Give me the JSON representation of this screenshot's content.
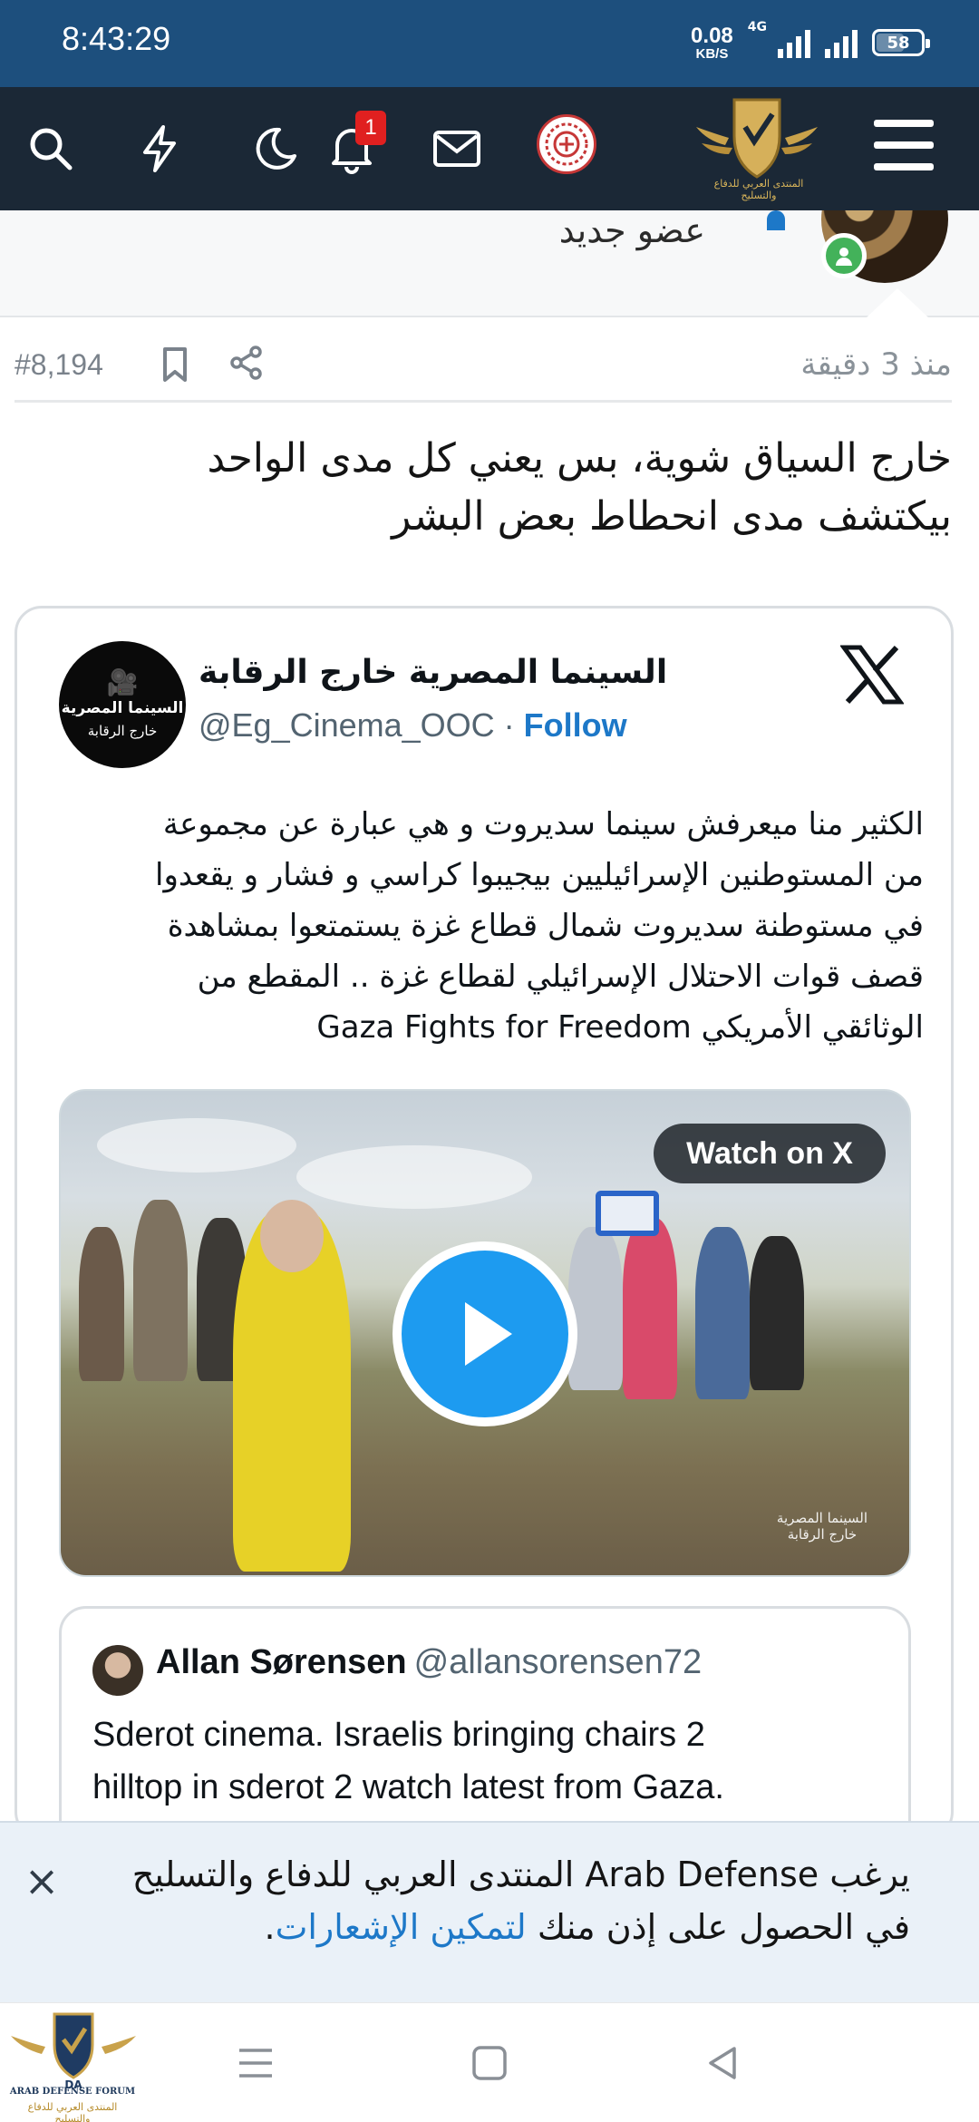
{
  "status_bar": {
    "time": "8:43:29",
    "net_speed": "0.08",
    "net_unit": "KB/S",
    "network_type": "4G",
    "battery": "58"
  },
  "nav": {
    "notification_count": "1",
    "icons": [
      "search-icon",
      "bolt-icon",
      "moon-icon",
      "bell-icon",
      "mail-icon",
      "avatar",
      "forum-logo",
      "menu-icon"
    ],
    "logo_caption": "المنتدى العربي للدفاع والتسليح"
  },
  "post": {
    "member_title": "عضو جديد",
    "time_ago": "منذ 3 دقيقة",
    "number": "#8,194",
    "text_line1": "خارج السياق شوية، بس يعني كل مدى الواحد",
    "text_line2": "بيكتشف مدى انحطاط بعض البشر"
  },
  "tweet": {
    "avatar_line1": "السينما المصرية",
    "avatar_line2": "خارج الرقابة",
    "name": "السينما المصرية خارج الرقابة",
    "handle": "@Eg_Cinema_OOC",
    "separator": " · ",
    "follow_label": "Follow",
    "text_lines": [
      "الكثير منا ميعرفش سينما سديروت و هي عبارة عن مجموعة",
      "من المستوطنين الإسرائيليين بيجيبوا كراسي و فشار و يقعدوا",
      "في مستوطنة سديروت شمال قطاع غزة يستمتعوا بمشاهدة",
      "قصف قوات الاحتلال الإسرائيلي لقطاع غزة .. المقطع من",
      "الوثائقي الأمريكي Gaza Fights for Freedom"
    ],
    "watch_label": "Watch on X",
    "watermark_line1": "السينما المصرية",
    "watermark_line2": "خارج الرقابة",
    "quoted": {
      "name": "Allan Sørensen",
      "handle": "@allansorensen72",
      "text_lines": [
        "Sderot cinema. Israelis bringing chairs 2",
        "hilltop in sderot 2 watch latest from Gaza."
      ]
    }
  },
  "permission_banner": {
    "line1": "يرغب Arab Defense المنتدى العربي للدفاع والتسليح",
    "line2_plain": "في الحصول على إذن منك ",
    "line2_link": "لتمكين الإشعارات",
    "line2_end": "."
  },
  "system_nav": {
    "logo_line1": "ARAB DEFENSE FORUM",
    "logo_line2": "المنتدى العربي للدفاع والتسليح"
  },
  "colors": {
    "status_bar": "#1d4f7d",
    "nav_bar": "#1b2836",
    "link": "#1d78c8",
    "play": "#1d9bf0",
    "badge": "#e02020"
  }
}
